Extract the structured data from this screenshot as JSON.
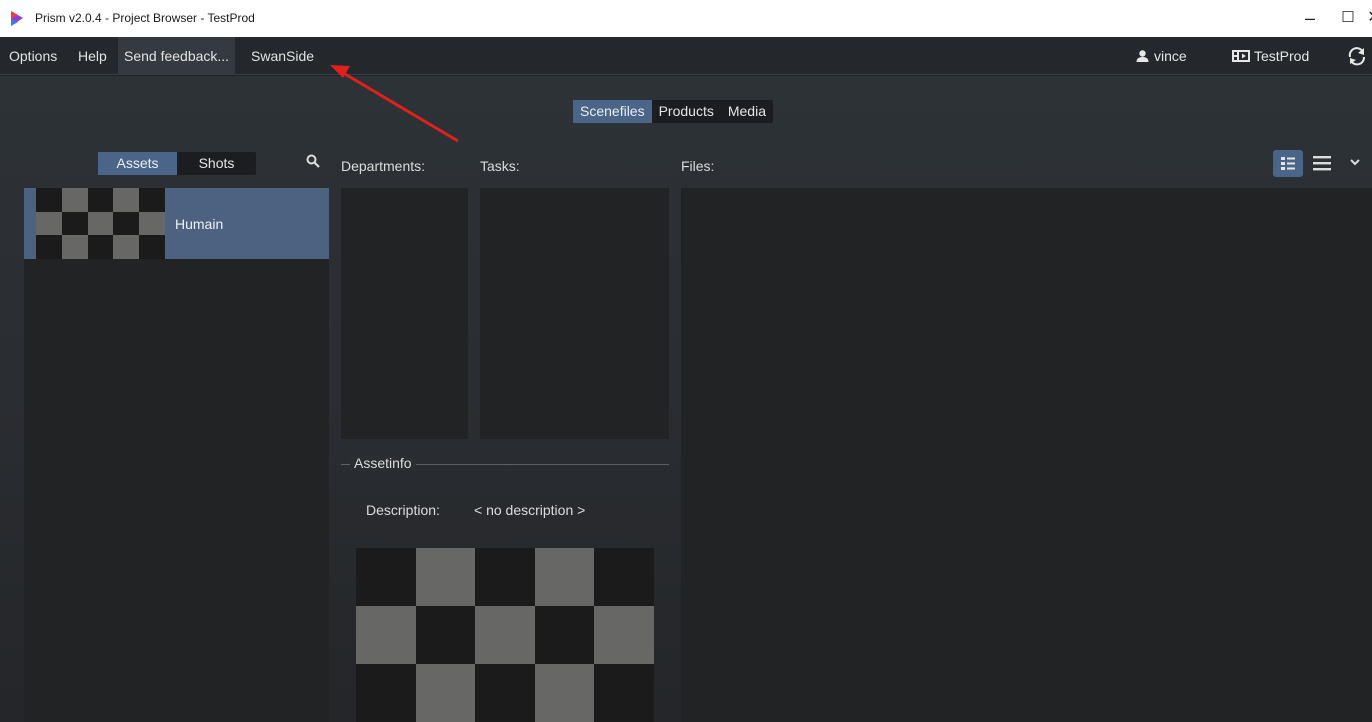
{
  "window": {
    "title": "Prism v2.0.4 - Project Browser - TestProd",
    "controls": {
      "minimize": "–",
      "maximize": "☐",
      "close": "✕"
    }
  },
  "menu": {
    "items": [
      "Options",
      "Help",
      "Send feedback...",
      "SwanSide"
    ],
    "user": "vince",
    "project": "TestProd"
  },
  "main_tabs": [
    {
      "label": "Scenefiles",
      "active": true
    },
    {
      "label": "Products",
      "active": false
    },
    {
      "label": "Media",
      "active": false
    }
  ],
  "entity_tabs": [
    {
      "label": "Assets",
      "active": true
    },
    {
      "label": "Shots",
      "active": false
    }
  ],
  "headers": {
    "departments": "Departments:",
    "tasks": "Tasks:",
    "files": "Files:"
  },
  "assets": [
    {
      "name": "Humain",
      "selected": true
    }
  ],
  "asset_info": {
    "title": "Assetinfo",
    "description_label": "Description:",
    "description_value": "< no description >"
  },
  "colors": {
    "accent": "#4a6587",
    "selection": "#4d6181",
    "annotation_arrow": "#e0201c"
  },
  "icons": [
    "prism-logo-icon",
    "user-icon",
    "project-icon",
    "refresh-icon",
    "search-icon",
    "detail-view-icon",
    "list-view-icon",
    "chevron-down-icon"
  ]
}
